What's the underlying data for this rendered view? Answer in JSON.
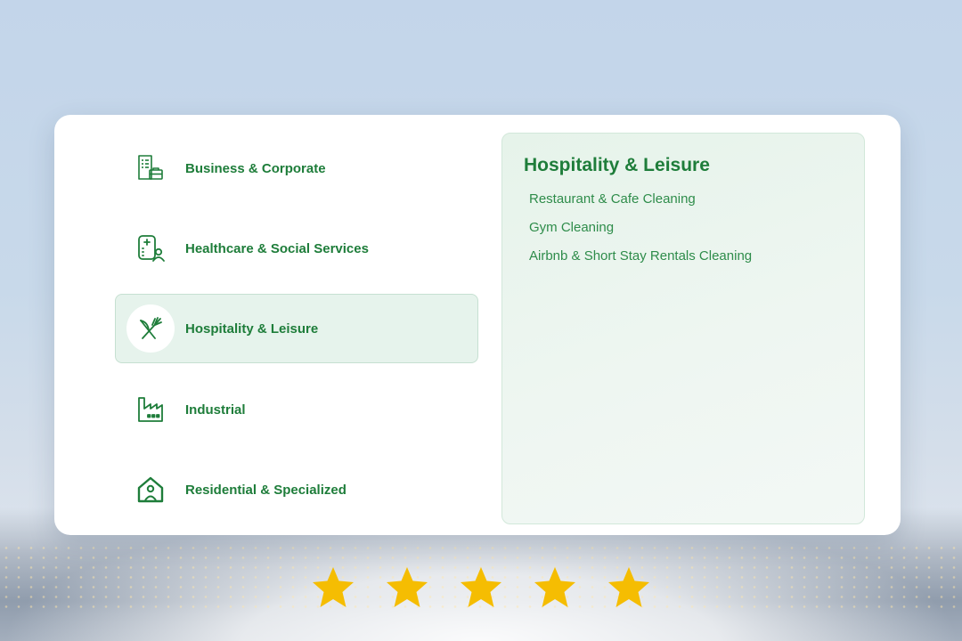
{
  "categories": [
    {
      "label": "Business & Corporate",
      "icon": "office-building-icon",
      "active": false
    },
    {
      "label": "Healthcare & Social Services",
      "icon": "medical-clipboard-icon",
      "active": false
    },
    {
      "label": "Hospitality & Leisure",
      "icon": "fork-knife-icon",
      "active": true
    },
    {
      "label": "Industrial",
      "icon": "factory-icon",
      "active": false
    },
    {
      "label": "Residential & Specialized",
      "icon": "house-person-icon",
      "active": false
    }
  ],
  "detail": {
    "title": "Hospitality & Leisure",
    "items": [
      "Restaurant & Cafe Cleaning",
      "Gym Cleaning",
      "Airbnb & Short Stay Rentals Cleaning"
    ]
  },
  "rating": {
    "value": 5,
    "max": 5,
    "icon": "star-icon"
  },
  "colors": {
    "accent": "#1e7d3a",
    "star": "#f5bd02",
    "active_bg": "#e6f3ec"
  }
}
